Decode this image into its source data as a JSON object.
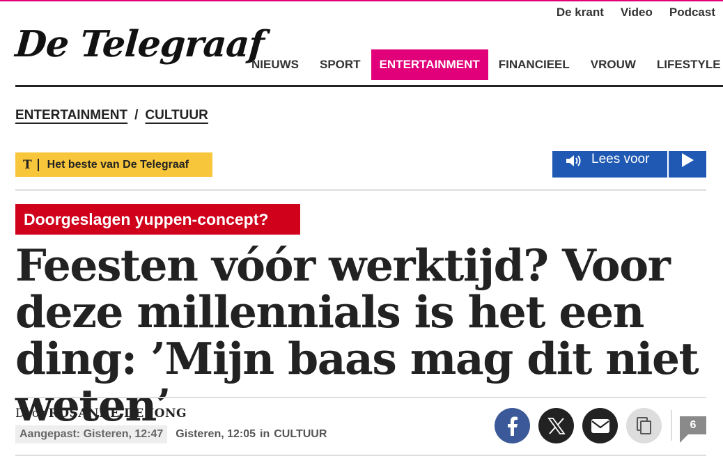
{
  "util_nav": [
    "De krant",
    "Video",
    "Podcast"
  ],
  "logo": "De Telegraaf",
  "main_nav": [
    "NIEUWS",
    "SPORT",
    "ENTERTAINMENT",
    "FINANCIEEL",
    "VROUW",
    "LIFESTYLE"
  ],
  "main_nav_active": "ENTERTAINMENT",
  "breadcrumb": {
    "section": "ENTERTAINMENT",
    "separator": "/",
    "subsection": "CULTUUR"
  },
  "best_badge": {
    "icon": "T",
    "label": "Het beste van De Telegraaf"
  },
  "lees_voor": {
    "label": "Lees voor",
    "icon": "speaker-icon",
    "play_icon": "play-icon"
  },
  "article": {
    "kicker": "Doorgeslagen yuppen-concept?",
    "headline": "Feesten vóór werktijd? Voor deze millennials is het een ding: ’Mijn baas mag dit niet weten’",
    "byline_prefix": "Door",
    "author": "ROSANNE DE JONG",
    "updated": "Aangepast: Gisteren, 12:47",
    "published": "Gisteren, 12:05",
    "in_label": "in",
    "section": "CULTUUR"
  },
  "share": [
    "facebook-icon",
    "x-icon",
    "mail-icon",
    "copy-icon"
  ],
  "comments_count": "6",
  "colors": {
    "brand_pink": "#e2007a",
    "kicker_red": "#d0021b",
    "badge_yellow": "#f8c63a",
    "lees_voor_blue": "#1f59b3",
    "facebook_blue": "#3b5998"
  }
}
